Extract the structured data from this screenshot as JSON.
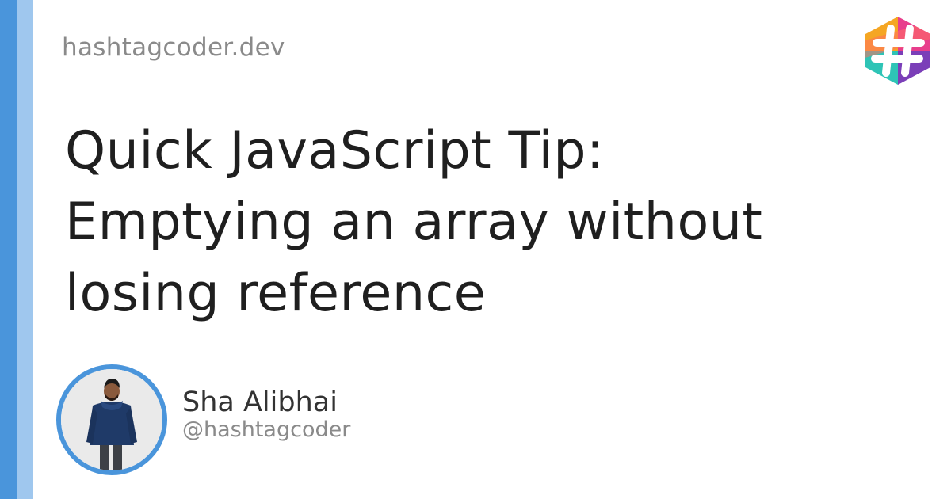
{
  "site": {
    "url": "hashtagcoder.dev"
  },
  "article": {
    "title_lines": [
      "Quick JavaScript Tip:",
      "Emptying an array without",
      "losing reference"
    ]
  },
  "author": {
    "name": "Sha Alibhai",
    "handle": "@hashtagcoder"
  },
  "logo": {
    "icon": "hashtag-logo-icon",
    "colors": [
      "#f5a623",
      "#e83e8c",
      "#2ec4b6",
      "#7b3fb8"
    ]
  },
  "avatar": {
    "icon": "author-avatar-photo"
  },
  "colors": {
    "accent_dark": "#4a95db",
    "accent_light": "#9fc7ee",
    "title": "#1f1f1f",
    "muted": "#8a8a8a"
  }
}
